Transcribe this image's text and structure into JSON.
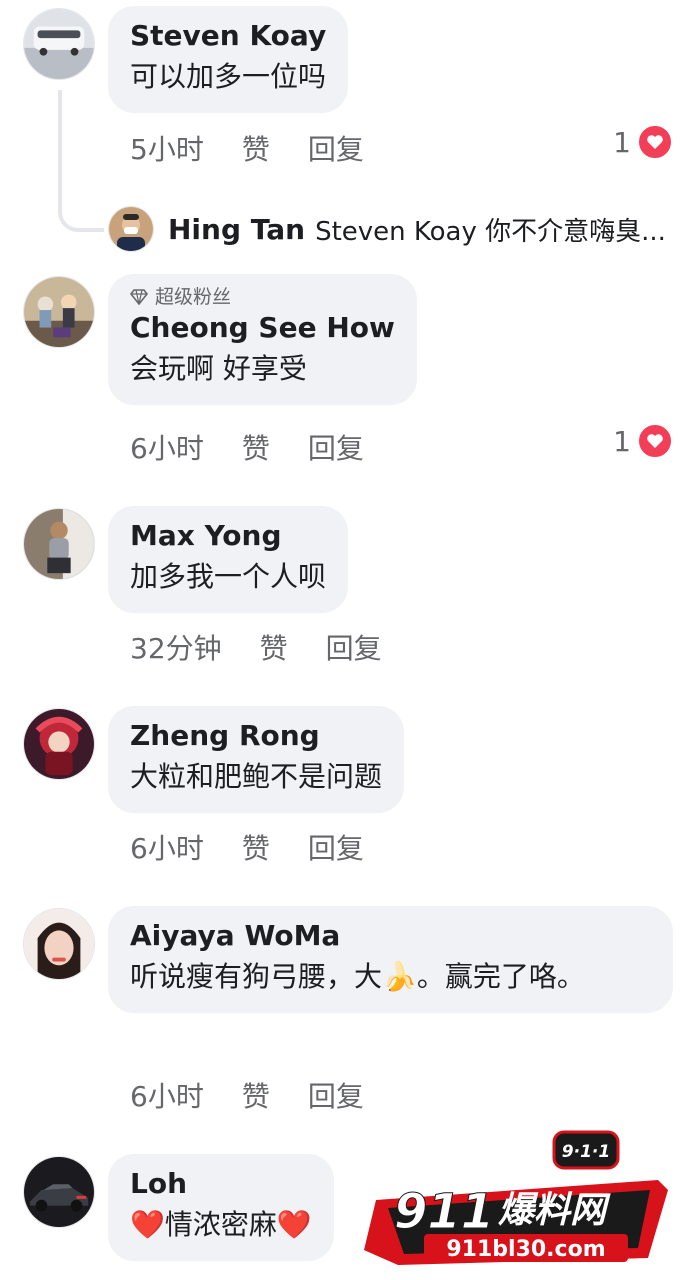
{
  "comments": [
    {
      "name": "Steven Koay",
      "text": "可以加多一位吗",
      "time": "5小时",
      "like": "赞",
      "reply": "回复",
      "reaction_count": "1",
      "avatar": "car-photo-avatar"
    },
    {
      "badge": "超级粉丝",
      "name": "Cheong See How",
      "text": "会玩啊 好享受",
      "time": "6小时",
      "like": "赞",
      "reply": "回复",
      "reaction_count": "1",
      "avatar": "figurine-photo-avatar"
    },
    {
      "name": "Max Yong",
      "text": "加多我一个人呗",
      "time": "32分钟",
      "like": "赞",
      "reply": "回复",
      "avatar": "person-photo-avatar"
    },
    {
      "name": "Zheng Rong",
      "text": "大粒和肥鲍不是问题",
      "time": "6小时",
      "like": "赞",
      "reply": "回复",
      "avatar": "anime-character-avatar"
    },
    {
      "name": "Aiyaya WoMa",
      "text_before_emoji": "听说瘦有狗弓腰，大",
      "emoji": "🍌",
      "text_after_emoji": "。赢完了咯。",
      "time": "6小时",
      "like": "赞",
      "reply": "回复",
      "avatar": "woman-photo-avatar"
    },
    {
      "name": "Loh",
      "text_middle": "情浓密麻",
      "emoji_left": "❤️",
      "emoji_right": "❤️",
      "avatar": "sports-car-avatar"
    }
  ],
  "thread_reply": {
    "name": "Hing Tan",
    "text": "Steven Koay 你不介意嗨臭..."
  },
  "watermark": {
    "top_badge": "9·1·1",
    "title_num": "911",
    "title_cn": "爆料网",
    "url": "911bl30.com"
  },
  "colors": {
    "bubble": "#f0f2f5",
    "meta_text": "#65676b",
    "heart": "#f33e58",
    "watermark_red": "#d8121b"
  }
}
